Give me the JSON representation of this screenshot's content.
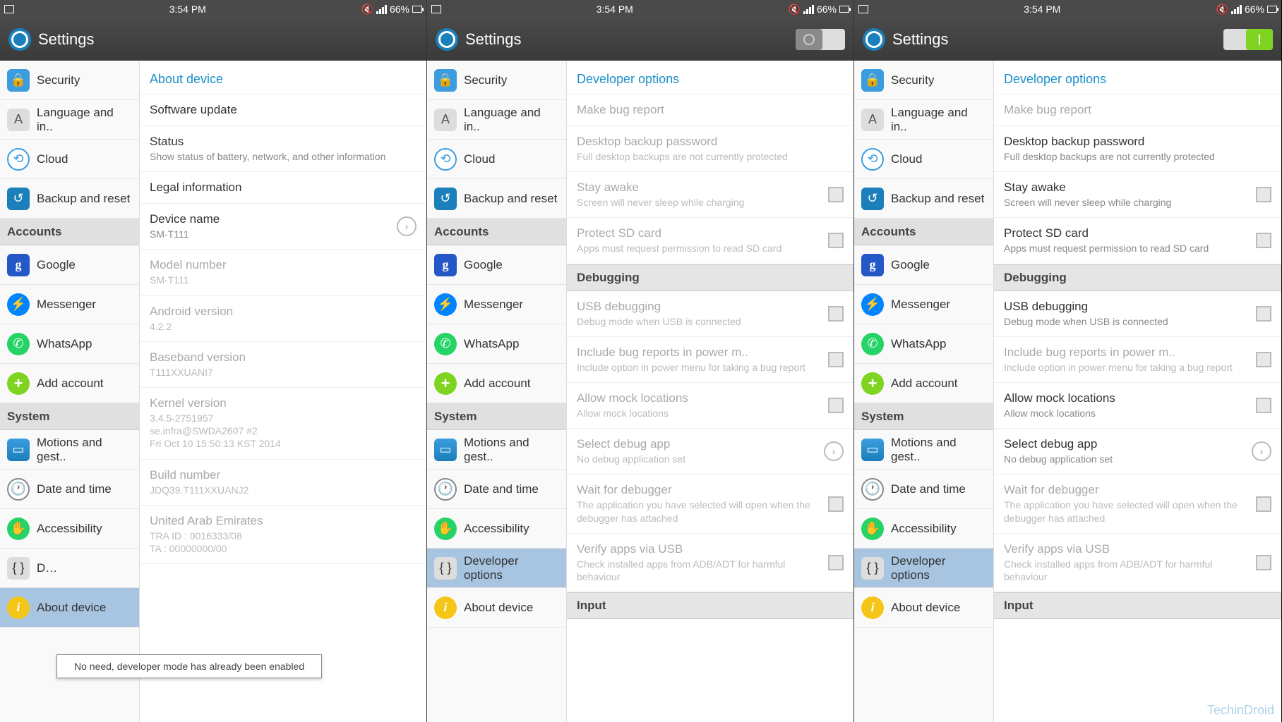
{
  "status": {
    "time": "3:54 PM",
    "battery": "66%"
  },
  "header": {
    "title": "Settings"
  },
  "sidebar": {
    "items": [
      {
        "label": "Security"
      },
      {
        "label": "Language and in.."
      },
      {
        "label": "Cloud"
      },
      {
        "label": "Backup and reset"
      }
    ],
    "accounts_header": "Accounts",
    "accounts": [
      {
        "label": "Google"
      },
      {
        "label": "Messenger"
      },
      {
        "label": "WhatsApp"
      },
      {
        "label": "Add account"
      }
    ],
    "system_header": "System",
    "system": [
      {
        "label": "Motions and gest.."
      },
      {
        "label": "Date and time"
      },
      {
        "label": "Accessibility"
      },
      {
        "label": "Developer options",
        "short": "D…"
      },
      {
        "label": "About device"
      }
    ]
  },
  "about": {
    "header": "About device",
    "software_update": "Software update",
    "status_title": "Status",
    "status_sub": "Show status of battery, network, and other information",
    "legal": "Legal information",
    "device_name_title": "Device name",
    "device_name_value": "SM-T111",
    "model_title": "Model number",
    "model_value": "SM-T111",
    "android_title": "Android version",
    "android_value": "4.2.2",
    "baseband_title": "Baseband version",
    "baseband_value": "T111XXUANI7",
    "kernel_title": "Kernel version",
    "kernel_value": "3.4.5-2751957\nse.infra@SWDA2607 #2\nFri Oct 10 15:50:13 KST 2014",
    "build_title": "Build number",
    "build_value": "JDQ39.T111XXUANJ2",
    "uae_title": "United Arab Emirates",
    "uae_value": "TRA ID : 0016333/08\nTA : 00000000/00"
  },
  "dev": {
    "header": "Developer options",
    "bug_report": "Make bug report",
    "desktop_title": "Desktop backup password",
    "desktop_sub": "Full desktop backups are not currently protected",
    "stay_title": "Stay awake",
    "stay_sub": "Screen will never sleep while charging",
    "protect_title": "Protect SD card",
    "protect_sub": "Apps must request permission to read SD card",
    "debugging_header": "Debugging",
    "usb_title": "USB debugging",
    "usb_sub": "Debug mode when USB is connected",
    "power_title": "Include bug reports in power m..",
    "power_sub": "Include option in power menu for taking a bug report",
    "mock_title": "Allow mock locations",
    "mock_sub": "Allow mock locations",
    "select_title": "Select debug app",
    "select_sub": "No debug application set",
    "wait_title": "Wait for debugger",
    "wait_sub": "The application you have selected will open when the debugger has attached",
    "verify_title": "Verify apps via USB",
    "verify_sub": "Check installed apps from ADB/ADT for harmful behaviour",
    "input_header": "Input"
  },
  "toast": "No need, developer mode has already been enabled",
  "watermark": "TechinDroid"
}
